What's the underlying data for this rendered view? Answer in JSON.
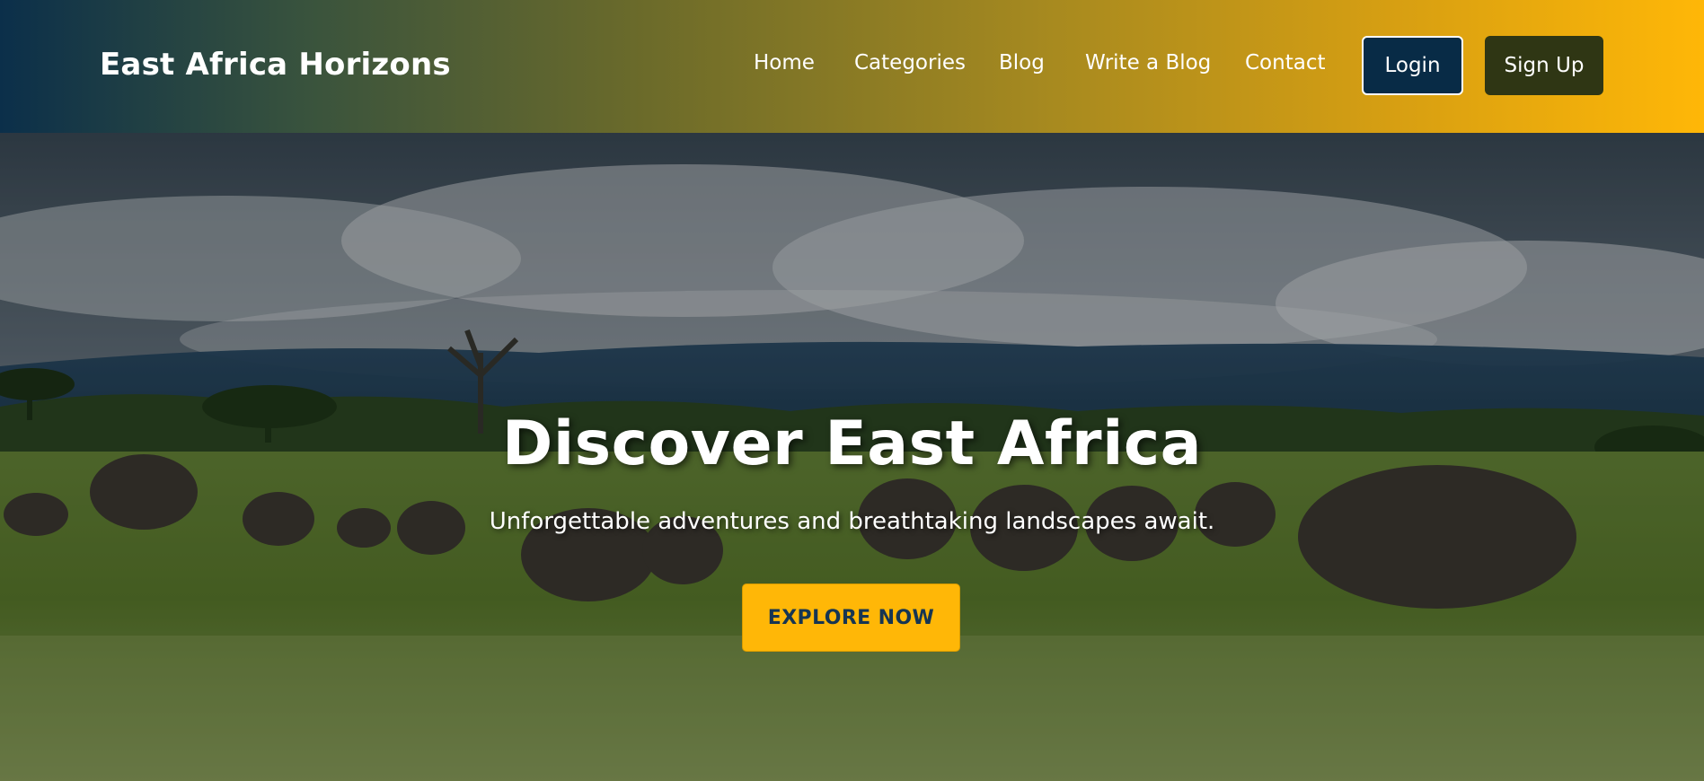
{
  "header": {
    "brand": "East Africa Horizons",
    "nav": {
      "home": "Home",
      "categories": "Categories",
      "blog": "Blog",
      "write": "Write a Blog",
      "contact": "Contact"
    },
    "login_label": "Login",
    "signup_label": "Sign Up"
  },
  "hero": {
    "title": "Discover East Africa",
    "subtitle": "Unforgettable adventures and breathtaking landscapes await.",
    "cta_label": "EXPLORE NOW",
    "background_image": "savanna-with-elephants"
  },
  "colors": {
    "header_gradient_start": "#0b2f4a",
    "header_gradient_end": "#ffb707",
    "login_bg": "#082b46",
    "signup_bg": "#2f3614",
    "cta_bg": "#ffb707",
    "cta_text": "#163552"
  }
}
